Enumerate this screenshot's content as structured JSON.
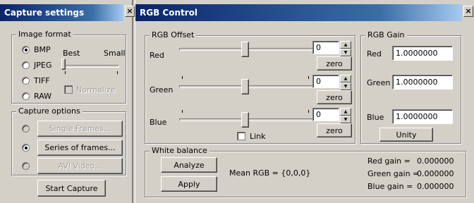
{
  "capture": {
    "title": "Capture settings",
    "close_glyph": "×",
    "image_format": {
      "label": "Image format",
      "options": [
        "BMP",
        "JPEG",
        "TIFF",
        "RAW"
      ],
      "selected": "BMP",
      "quality_best": "Best",
      "quality_small": "Small",
      "normalize": "Normalize"
    },
    "capture_options": {
      "label": "Capture options",
      "single": "Single Frames...",
      "series": "Series of frames...",
      "avi": "AVI Video...",
      "selected": "Series of frames..."
    },
    "start": "Start Capture"
  },
  "rgb": {
    "title": "RGB Control",
    "close_glyph": "×",
    "offset": {
      "label": "RGB Offset",
      "red_label": "Red",
      "green_label": "Green",
      "blue_label": "Blue",
      "red_value": "0",
      "green_value": "0",
      "blue_value": "0",
      "zero": "zero",
      "link": "Link"
    },
    "gain": {
      "label": "RGB Gain",
      "red_label": "Red",
      "green_label": "Green",
      "blue_label": "Blue",
      "red_value": "1.0000000",
      "green_value": "1.0000000",
      "blue_value": "1.0000000",
      "unity": "Unity"
    },
    "white_balance": {
      "label": "White balance",
      "analyze": "Analyze",
      "apply": "Apply",
      "mean": "Mean RGB = {0,0,0}",
      "red_gain_label": "Red gain =",
      "red_gain_value": "0.000000",
      "green_gain_label": "Green gain =",
      "green_gain_value": "0.000000",
      "blue_gain_label": "Blue gain =",
      "blue_gain_value": "0.000000"
    }
  },
  "colors": {
    "title_dark": "#0a246a",
    "title_light": "#a6caf0",
    "face": "#d4d0c8"
  },
  "icons": {
    "close": "close-icon",
    "spin_up": "spin-up-icon",
    "spin_down": "spin-down-icon"
  }
}
